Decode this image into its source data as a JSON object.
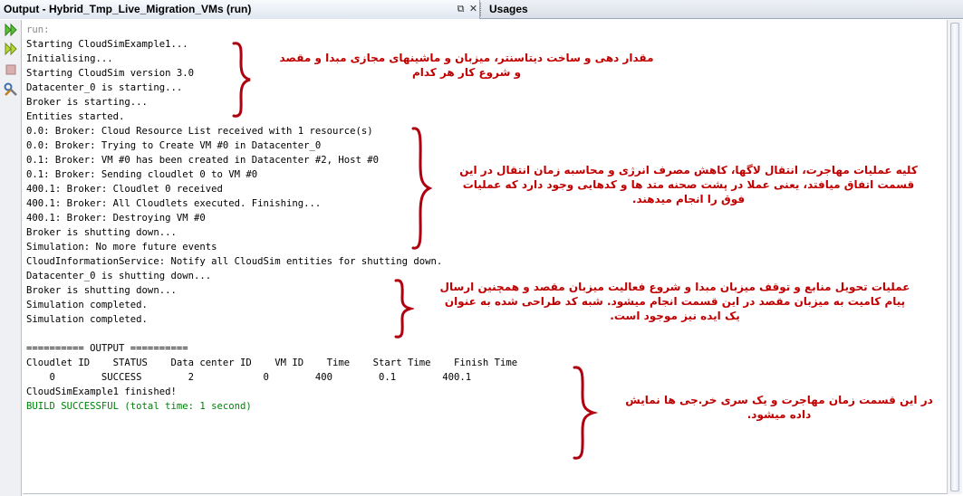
{
  "tabs": {
    "output_title": "Output - Hybrid_Tmp_Live_Migration_VMs (run)",
    "usages_title": "Usages",
    "restore_icon": "⧉",
    "close_icon": "✕"
  },
  "console": {
    "run_label": "run:",
    "lines": [
      "Starting CloudSimExample1...",
      "Initialising...",
      "Starting CloudSim version 3.0",
      "Datacenter_0 is starting...",
      "Broker is starting...",
      "Entities started.",
      "0.0: Broker: Cloud Resource List received with 1 resource(s)",
      "0.0: Broker: Trying to Create VM #0 in Datacenter_0",
      "0.1: Broker: VM #0 has been created in Datacenter #2, Host #0",
      "0.1: Broker: Sending cloudlet 0 to VM #0",
      "400.1: Broker: Cloudlet 0 received",
      "400.1: Broker: All Cloudlets executed. Finishing...",
      "400.1: Broker: Destroying VM #0",
      "Broker is shutting down...",
      "Simulation: No more future events",
      "CloudInformationService: Notify all CloudSim entities for shutting down.",
      "Datacenter_0 is shutting down...",
      "Broker is shutting down...",
      "Simulation completed.",
      "Simulation completed.",
      "",
      "========== OUTPUT ==========",
      "Cloudlet ID    STATUS    Data center ID    VM ID    Time    Start Time    Finish Time",
      "    0        SUCCESS        2            0        400        0.1        400.1",
      "CloudSimExample1 finished!"
    ],
    "build_status": "BUILD SUCCESSFUL (total time: 1 second)"
  },
  "annotations": {
    "note1": "مقدار دهی و ساخت دیتاسنتر، میزبان و ماشینهای مجازی مبدا و مقصد و شروع کار هر کدام",
    "note2": "کلیه عملیات مهاجرت، انتقال لاگها، کاهش مصرف انرژی و محاسبه زمان انتقال در این قسمت اتفاق میافتد، یعنی عملا در پشت صحنه متد ها و کدهایی وجود دارد که عملیات فوق را انجام میدهند.",
    "note3": "عملیات تحویل منابع و توقف میزبان مبدا و شروع فعالیت میزبان مقصد و همچنین ارسال پیام کامیت به میزبان مقصد در این قسمت انجام میشود. شبه کد طراحی شده به عنوان یک ایده نیز موجود است.",
    "note4": "در این قسمت زمان مهاجرت و یک سری خر.جی ها نمایش داده میشود.",
    "color": "#c00000"
  }
}
